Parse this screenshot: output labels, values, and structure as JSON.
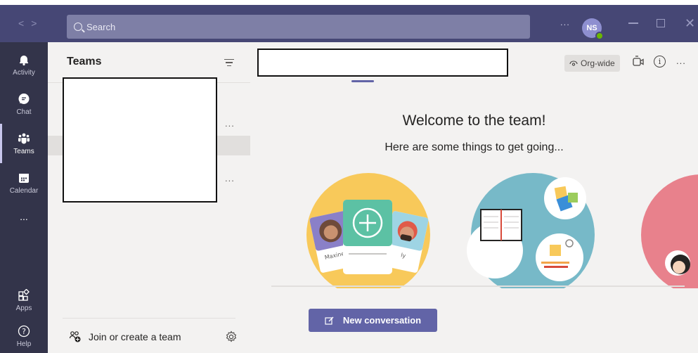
{
  "titlebar": {
    "search_placeholder": "Search",
    "more_label": "...",
    "user_initials": "NS",
    "presence_color": "#6bb700"
  },
  "rail": {
    "items": [
      {
        "label": "Activity",
        "icon": "bell-icon"
      },
      {
        "label": "Chat",
        "icon": "chat-icon"
      },
      {
        "label": "Teams",
        "icon": "teams-icon",
        "active": true
      },
      {
        "label": "Calendar",
        "icon": "calendar-icon"
      },
      {
        "label": "...",
        "icon": "more-apps-icon"
      },
      {
        "label": "Apps",
        "icon": "apps-icon"
      },
      {
        "label": "Help",
        "icon": "help-icon"
      }
    ]
  },
  "pane": {
    "title": "Teams",
    "row_more": "...",
    "join_label": "Join or create a team"
  },
  "main": {
    "org_wide": "Org-wide",
    "more_label": "...",
    "welcome_title": "Welcome to the team!",
    "welcome_sub": "Here are some things to get going...",
    "card_left_name": "Maxine",
    "card_right_name": "ly",
    "new_conversation": "New conversation"
  },
  "colors": {
    "titlebar": "#464775",
    "rail": "#33344a",
    "accent": "#6264a7"
  }
}
